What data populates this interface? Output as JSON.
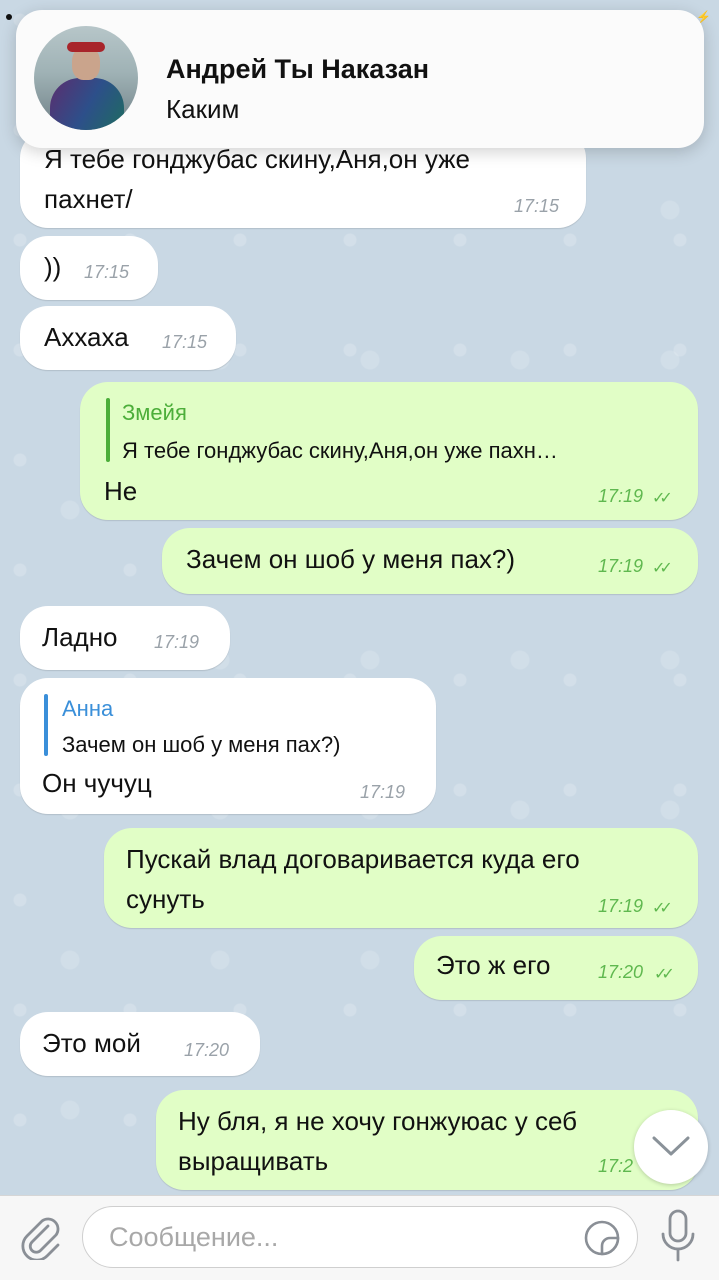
{
  "notification": {
    "sender": "Андрей Ты Наказан",
    "text": "Каким"
  },
  "messages": [
    {
      "dir": "in",
      "text_line1": "Я тебе гонджубас скину,Аня,он уже",
      "text_line2": "пахнет/",
      "time": "17:15"
    },
    {
      "dir": "in",
      "text": "))",
      "time": "17:15"
    },
    {
      "dir": "in",
      "text": "Аххаха",
      "time": "17:15"
    },
    {
      "dir": "out",
      "reply_name": "Змейя",
      "reply_text": "Я тебе гонджубас скину,Аня,он уже пахн…",
      "text": "Не",
      "time": "17:19"
    },
    {
      "dir": "out",
      "text": "Зачем он шоб у меня пах?)",
      "time": "17:19"
    },
    {
      "dir": "in",
      "text": "Ладно",
      "time": "17:19"
    },
    {
      "dir": "in",
      "reply_name": "Анна",
      "reply_text": "Зачем он шоб у меня пах?)",
      "text": "Он чучуц",
      "time": "17:19"
    },
    {
      "dir": "out",
      "text_line1": "Пускай влад договаривается куда его",
      "text_line2": "сунуть",
      "time": "17:19"
    },
    {
      "dir": "out",
      "text": "Это ж его",
      "time": "17:20"
    },
    {
      "dir": "in",
      "text": "Это мой",
      "time": "17:20"
    },
    {
      "dir": "out",
      "text_line1": "Ну бля, я не хочу гонжуюас у себ",
      "text_line2": "выращивать",
      "time": "17:2"
    }
  ],
  "input": {
    "placeholder": "Сообщение..."
  },
  "icons": {
    "attach": "paperclip-icon",
    "sticker": "sticker-icon",
    "mic": "microphone-icon",
    "scroll": "chevron-down-icon"
  },
  "colors": {
    "incoming_bubble": "#ffffff",
    "outgoing_bubble": "#e1fec6",
    "reply_out": "#4cae3a",
    "reply_in": "#3a8fd9"
  }
}
